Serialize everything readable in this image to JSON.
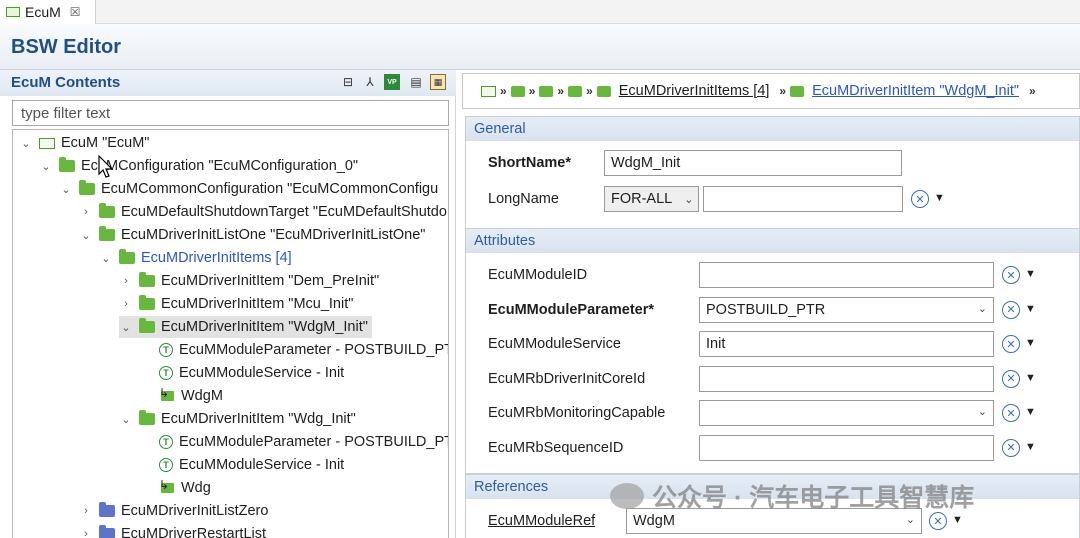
{
  "tab": {
    "label": "EcuM",
    "close": "☒"
  },
  "header": {
    "title": "BSW Editor"
  },
  "left": {
    "title": "EcuM Contents",
    "filter_placeholder": "type filter text",
    "tree": [
      {
        "level": 0,
        "twisty": "⌄",
        "icon": "module",
        "label": "EcuM \"EcuM\""
      },
      {
        "level": 1,
        "twisty": "⌄",
        "icon": "folder",
        "label": "EcuMConfiguration \"EcuMConfiguration_0\""
      },
      {
        "level": 2,
        "twisty": "⌄",
        "icon": "folder",
        "label": "EcuMCommonConfiguration \"EcuMCommonConfigu"
      },
      {
        "level": 3,
        "twisty": "›",
        "icon": "folder",
        "label": "EcuMDefaultShutdownTarget \"EcuMDefaultShutdo"
      },
      {
        "level": 3,
        "twisty": "⌄",
        "icon": "folder",
        "label": "EcuMDriverInitListOne \"EcuMDriverInitListOne\""
      },
      {
        "level": 4,
        "twisty": "⌄",
        "icon": "folder",
        "label": "EcuMDriverInitItems [4]",
        "link": true
      },
      {
        "level": 5,
        "twisty": "›",
        "icon": "folder",
        "label": "EcuMDriverInitItem \"Dem_PreInit\""
      },
      {
        "level": 5,
        "twisty": "›",
        "icon": "folder",
        "label": "EcuMDriverInitItem \"Mcu_Init\""
      },
      {
        "level": 5,
        "twisty": "⌄",
        "icon": "folder",
        "label": "EcuMDriverInitItem \"WdgM_Init\"",
        "selected": true
      },
      {
        "level": 6,
        "twisty": "",
        "icon": "text",
        "label": "EcuMModuleParameter - POSTBUILD_PTR"
      },
      {
        "level": 6,
        "twisty": "",
        "icon": "text",
        "label": "EcuMModuleService - Init"
      },
      {
        "level": 6,
        "twisty": "",
        "icon": "ref",
        "label": "WdgM"
      },
      {
        "level": 5,
        "twisty": "⌄",
        "icon": "folder",
        "label": "EcuMDriverInitItem \"Wdg_Init\""
      },
      {
        "level": 6,
        "twisty": "",
        "icon": "text",
        "label": "EcuMModuleParameter - POSTBUILD_PTR"
      },
      {
        "level": 6,
        "twisty": "",
        "icon": "text",
        "label": "EcuMModuleService - Init"
      },
      {
        "level": 6,
        "twisty": "",
        "icon": "ref",
        "label": "Wdg"
      },
      {
        "level": 3,
        "twisty": "›",
        "icon": "folder-blue",
        "label": "EcuMDriverInitListZero"
      },
      {
        "level": 3,
        "twisty": "›",
        "icon": "folder-blue",
        "label": "EcuMDriverRestartList"
      }
    ]
  },
  "breadcrumb": {
    "sep": "»",
    "items_link": "EcuMDriverInitItems [4]",
    "current": "EcuMDriverInitItem \"WdgM_Init\""
  },
  "general": {
    "title": "General",
    "shortname_label": "ShortName*",
    "shortname_value": "WdgM_Init",
    "longname_label": "LongName",
    "longname_lang": "FOR-ALL",
    "longname_value": ""
  },
  "attributes": {
    "title": "Attributes",
    "rows": [
      {
        "label": "EcuMModuleID",
        "value": "",
        "bold": false,
        "select": false
      },
      {
        "label": "EcuMModuleParameter*",
        "value": "POSTBUILD_PTR",
        "bold": true,
        "select": true
      },
      {
        "label": "EcuMModuleService",
        "value": "Init",
        "bold": false,
        "select": false
      },
      {
        "label": "EcuMRbDriverInitCoreId",
        "value": "",
        "bold": false,
        "select": false
      },
      {
        "label": "EcuMRbMonitoringCapable",
        "value": "",
        "bold": false,
        "select": true
      },
      {
        "label": "EcuMRbSequenceID",
        "value": "",
        "bold": false,
        "select": false
      }
    ]
  },
  "references": {
    "title": "References",
    "label": "EcuMModuleRef",
    "value": "WdgM"
  },
  "watermark": "公众号 · 汽车电子工具智慧库"
}
